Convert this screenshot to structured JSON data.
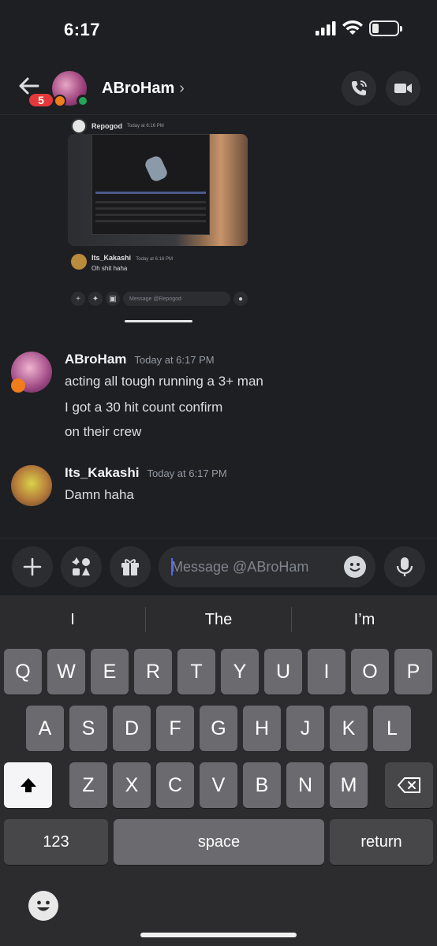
{
  "status": {
    "time": "6:17"
  },
  "header": {
    "back_badge": "5",
    "title": "ABroHam",
    "chevron": "›"
  },
  "embed": {
    "author": "Repogod",
    "author_time": "Today at 6:16 PM",
    "reply_name": "Its_Kakashi",
    "reply_time": "Today at 6:16 PM",
    "reply_text": "Oh shit haha",
    "input_placeholder": "Message @Repogod"
  },
  "messages": [
    {
      "author": "ABroHam",
      "timestamp": "Today at 6:17 PM",
      "lines": [
        "acting all tough running a 3+ man",
        "I got a 30 hit count confirm",
        "on their crew"
      ]
    },
    {
      "author": "Its_Kakashi",
      "timestamp": "Today at 6:17 PM",
      "lines": [
        "Damn haha"
      ]
    }
  ],
  "composer": {
    "placeholder": "Message @ABroHam"
  },
  "keyboard": {
    "suggestions": [
      "I",
      "The",
      "I’m"
    ],
    "row1": [
      "Q",
      "W",
      "E",
      "R",
      "T",
      "Y",
      "U",
      "I",
      "O",
      "P"
    ],
    "row2": [
      "A",
      "S",
      "D",
      "F",
      "G",
      "H",
      "J",
      "K",
      "L"
    ],
    "row3": [
      "Z",
      "X",
      "C",
      "V",
      "B",
      "N",
      "M"
    ],
    "numbers": "123",
    "space": "space",
    "return": "return"
  },
  "colors": {
    "accent": "#5865f2",
    "online": "#23a55a",
    "badge": "#e5383b"
  }
}
